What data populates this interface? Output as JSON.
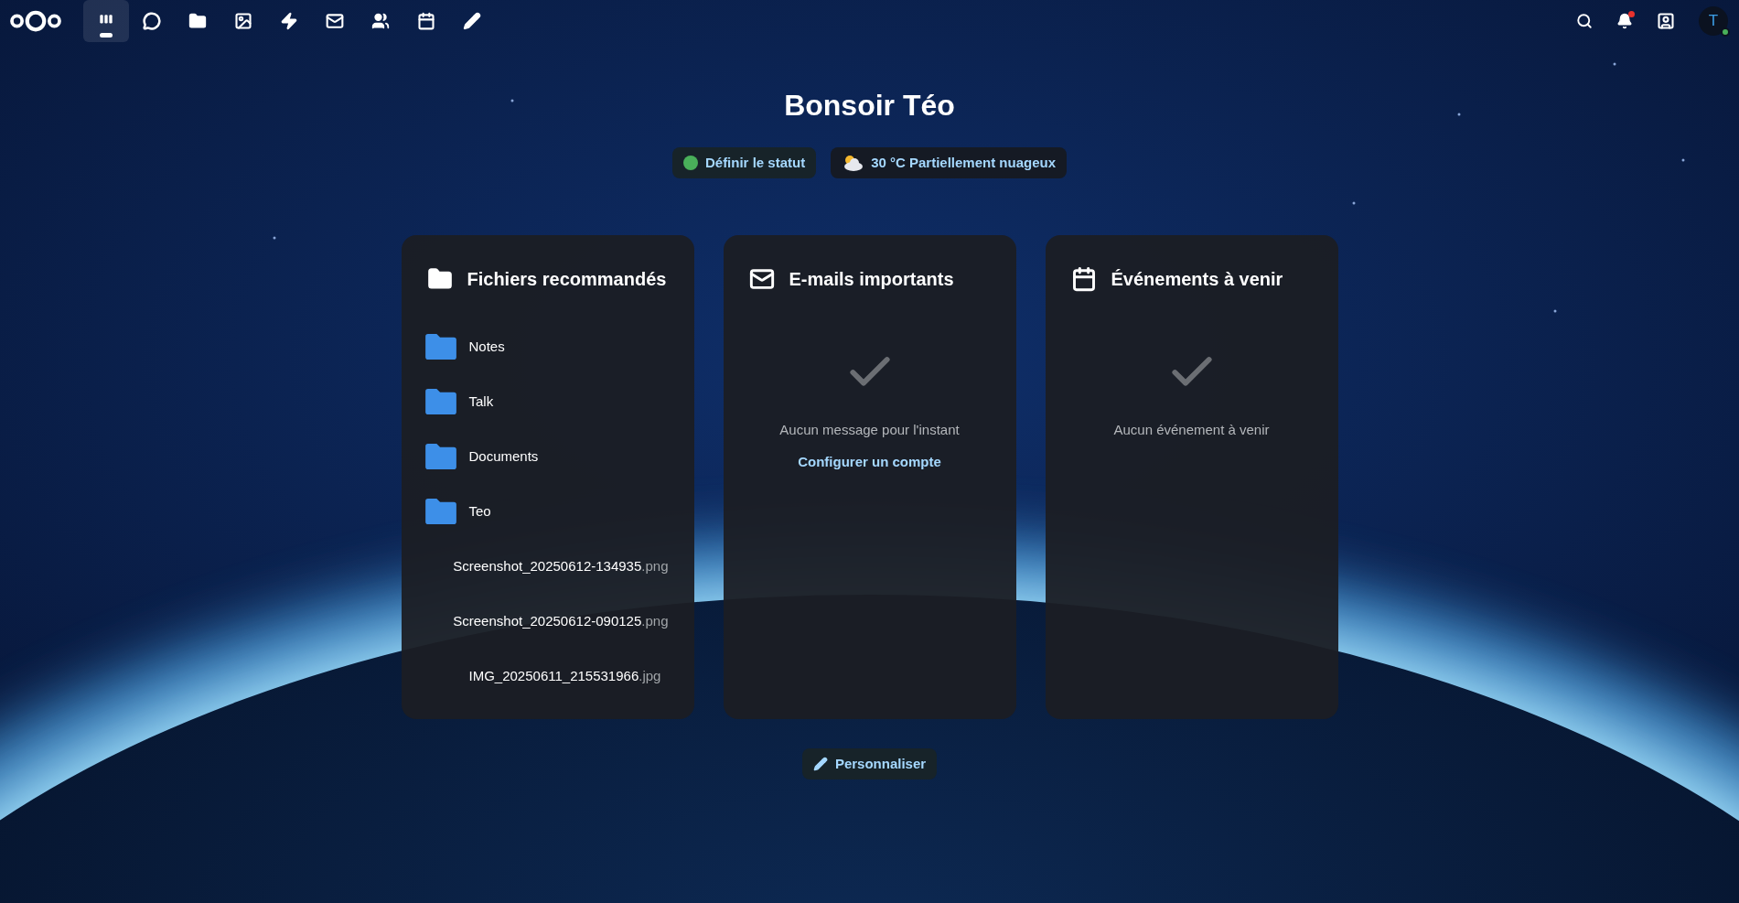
{
  "header": {
    "apps": [
      {
        "kind": "dashboard",
        "selected": true
      },
      {
        "kind": "talk",
        "selected": false
      },
      {
        "kind": "files",
        "selected": false
      },
      {
        "kind": "photos",
        "selected": false
      },
      {
        "kind": "activity",
        "selected": false
      },
      {
        "kind": "mail",
        "selected": false
      },
      {
        "kind": "contacts",
        "selected": false
      },
      {
        "kind": "calendar",
        "selected": false
      },
      {
        "kind": "notes",
        "selected": false
      }
    ],
    "notifications": {
      "unread": true
    },
    "avatar": {
      "initial": "T",
      "online": true
    }
  },
  "greeting": "Bonsoir Téo",
  "status": {
    "label": "Définir le statut",
    "online": true
  },
  "weather": {
    "label": "30 °C Partiellement nuageux"
  },
  "widgets": [
    {
      "kind": "files",
      "title": "Fichiers recommandés",
      "items": [
        {
          "kind": "folder",
          "name": "Notes"
        },
        {
          "kind": "folder",
          "name": "Talk"
        },
        {
          "kind": "folder",
          "name": "Documents"
        },
        {
          "kind": "folder",
          "name": "Teo"
        },
        {
          "kind": "file",
          "name": "Screenshot_20250612-134935",
          "extension": ".png"
        },
        {
          "kind": "file",
          "name": "Screenshot_20250612-090125",
          "extension": ".png"
        },
        {
          "kind": "file",
          "name": "IMG_20250611_215531966",
          "extension": ".jpg"
        }
      ]
    },
    {
      "kind": "mail",
      "title": "E-mails importants",
      "empty_message": "Aucun message pour l'instant",
      "action": "Configurer un compte"
    },
    {
      "kind": "calendar",
      "title": "Événements à venir",
      "empty_message": "Aucun événement à venir"
    }
  ],
  "customize_button": "Personnaliser"
}
